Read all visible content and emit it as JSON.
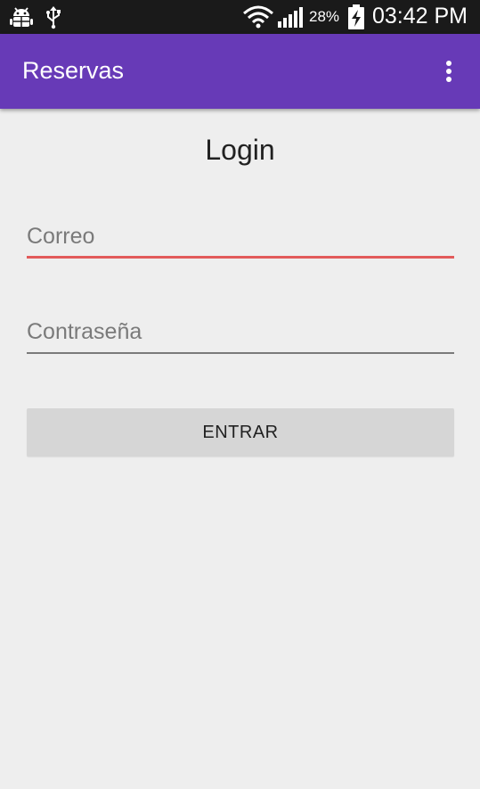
{
  "status_bar": {
    "battery_percent": "28%",
    "time": "03:42 PM",
    "icons": [
      "android-debug-icon",
      "usb-icon",
      "wifi-icon",
      "signal-icon",
      "battery-charging-icon"
    ]
  },
  "app_bar": {
    "title": "Reservas",
    "overflow_icon": "more-vert-icon"
  },
  "login": {
    "heading": "Login",
    "email_placeholder": "Correo",
    "password_placeholder": "Contraseña",
    "submit_label": "ENTRAR"
  },
  "colors": {
    "primary": "#673ab7",
    "status_bar": "#1a1a1a",
    "background": "#eeeeee",
    "email_underline_error": "#e25a5a",
    "button": "#d6d6d6"
  }
}
